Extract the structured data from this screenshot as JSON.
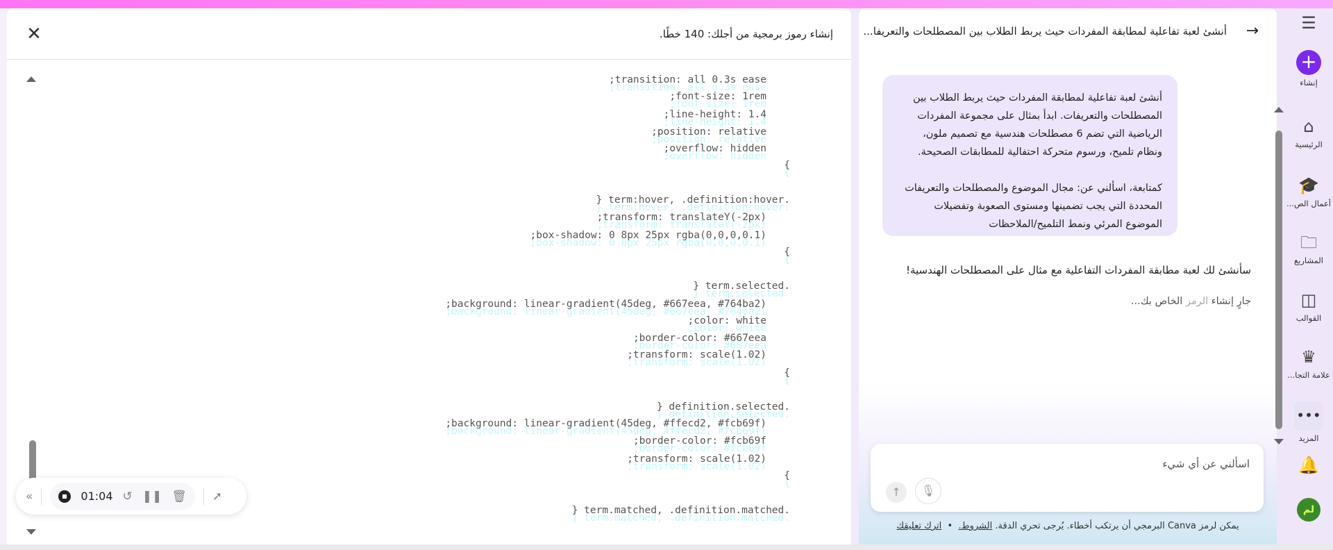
{
  "code_panel": {
    "title": "إنشاء رموز برمجية من أجلك: 140 خطًا.",
    "lines": [
      ";transition: all 0.3s ease",
      ";font-size: 1rem",
      ";line-height: 1.4",
      ";position: relative",
      ";overflow: hidden",
      "{",
      "} term:hover, .definition:hover.",
      ";transform: translateY(-2px)",
      ";box-shadow: 0 8px 25px rgba(0,0,0,0.1)",
      "{",
      "} term.selected.",
      ";background: linear-gradient(45deg, #667eea, #764ba2)",
      ";color: white",
      ";border-color: #667eea",
      ";transform: scale(1.02)",
      "{",
      "} definition.selected.",
      ";background: linear-gradient(45deg, #ffecd2, #fcb69f)",
      ";border-color: #fcb69f",
      ";transform: scale(1.02)",
      "{",
      "} term.matched, .definition.matched."
    ]
  },
  "recorder": {
    "time": "01:04"
  },
  "chat": {
    "title": "أنشئ لعبة تفاعلية لمطابقة المفردات حيث يربط الطلاب بين المصطلحات والتعريفا...",
    "user_message_p1": "أنشئ لعبة تفاعلية لمطابقة المفردات حيث يربط الطلاب بين المصطلحات والتعريفات. ابدأ بمثال على مجموعة المفردات الرياضية التي تضم 6 مصطلحات هندسية مع تصميم ملون، ونظام تلميح، ورسوم متحركة احتفالية للمطابقات الصحيحة.",
    "user_message_p2": "كمتابعة، اسألني عن: مجال الموضوع والمصطلحات والتعريفات المحددة التي يجب تضمينها ومستوى الصعوبة وتفضيلات الموضوع المرئي ونمط التلميح/الملاحظات",
    "assistant_message": "سأنشئ لك لعبة مطابقة المفردات التفاعلية مع مثال على المصطلحات الهندسية!",
    "generating_a": "جارٍ إنشاء",
    "generating_b": "الرمز",
    "generating_c": "الخاص بك...",
    "input_placeholder": "اسألني عن أي شيء",
    "footer_text": "يمكن لرمز Canva البرمجي أن يرتكب أخطاء. يُرجى تحري الدقة.",
    "footer_terms": "الشروط.",
    "footer_feedback": "اترك تعليقك"
  },
  "sidebar": {
    "create": "إنشاء",
    "home": "الرئيسية",
    "education": "أعمال الص...",
    "projects": "المشاريع",
    "templates": "القوالب",
    "brand": "علامة التجا...",
    "more": "المزيد",
    "avatar": "لم"
  }
}
